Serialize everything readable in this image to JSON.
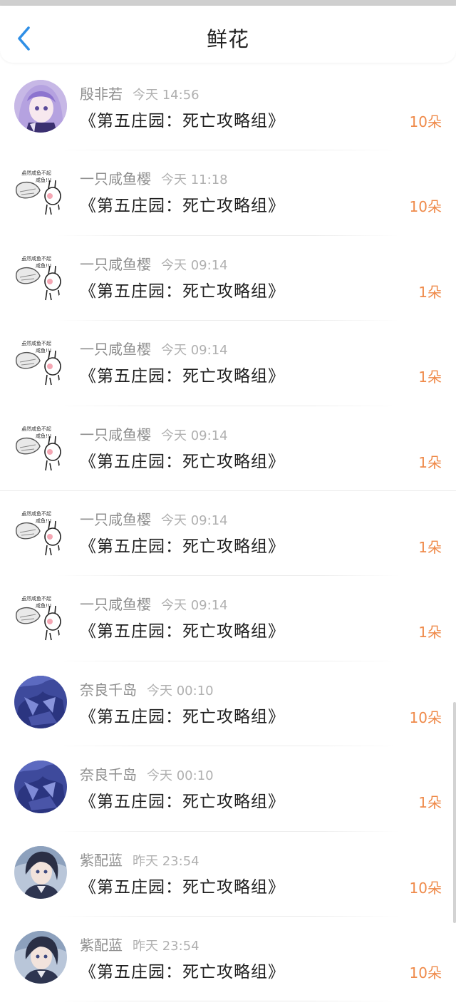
{
  "header": {
    "title": "鲜花"
  },
  "items": [
    {
      "avatar": "purple-hair-girl-avatar",
      "user": "殷非若",
      "time": "今天 14:56",
      "book": "《第五庄园：死亡攻略组》",
      "count": "10朵"
    },
    {
      "avatar": "sketch-fish-rabbit-avatar",
      "user": "一只咸鱼樱",
      "time": "今天 11:18",
      "book": "《第五庄园：死亡攻略组》",
      "count": "10朵"
    },
    {
      "avatar": "sketch-fish-rabbit-avatar",
      "user": "一只咸鱼樱",
      "time": "今天 09:14",
      "book": "《第五庄园：死亡攻略组》",
      "count": "1朵"
    },
    {
      "avatar": "sketch-fish-rabbit-avatar",
      "user": "一只咸鱼樱",
      "time": "今天 09:14",
      "book": "《第五庄园：死亡攻略组》",
      "count": "1朵"
    },
    {
      "avatar": "sketch-fish-rabbit-avatar",
      "user": "一只咸鱼樱",
      "time": "今天 09:14",
      "book": "《第五庄园：死亡攻略组》",
      "count": "1朵"
    },
    {
      "avatar": "sketch-fish-rabbit-avatar",
      "user": "一只咸鱼樱",
      "time": "今天 09:14",
      "book": "《第五庄园：死亡攻略组》",
      "count": "1朵"
    },
    {
      "avatar": "sketch-fish-rabbit-avatar",
      "user": "一只咸鱼樱",
      "time": "今天 09:14",
      "book": "《第五庄园：死亡攻略组》",
      "count": "1朵"
    },
    {
      "avatar": "blue-painting-avatar",
      "user": "奈良千岛",
      "time": "今天 00:10",
      "book": "《第五庄园：死亡攻略组》",
      "count": "10朵"
    },
    {
      "avatar": "blue-painting-avatar",
      "user": "奈良千岛",
      "time": "今天 00:10",
      "book": "《第五庄园：死亡攻略组》",
      "count": "1朵"
    },
    {
      "avatar": "dark-hair-man-avatar",
      "user": "紫配蓝",
      "time": "昨天 23:54",
      "book": "《第五庄园：死亡攻略组》",
      "count": "10朵"
    },
    {
      "avatar": "dark-hair-man-avatar",
      "user": "紫配蓝",
      "time": "昨天 23:54",
      "book": "《第五庄园：死亡攻略组》",
      "count": "10朵"
    }
  ],
  "colors": {
    "accent": "#ef8a4a",
    "back_icon": "#2f8fe6"
  }
}
